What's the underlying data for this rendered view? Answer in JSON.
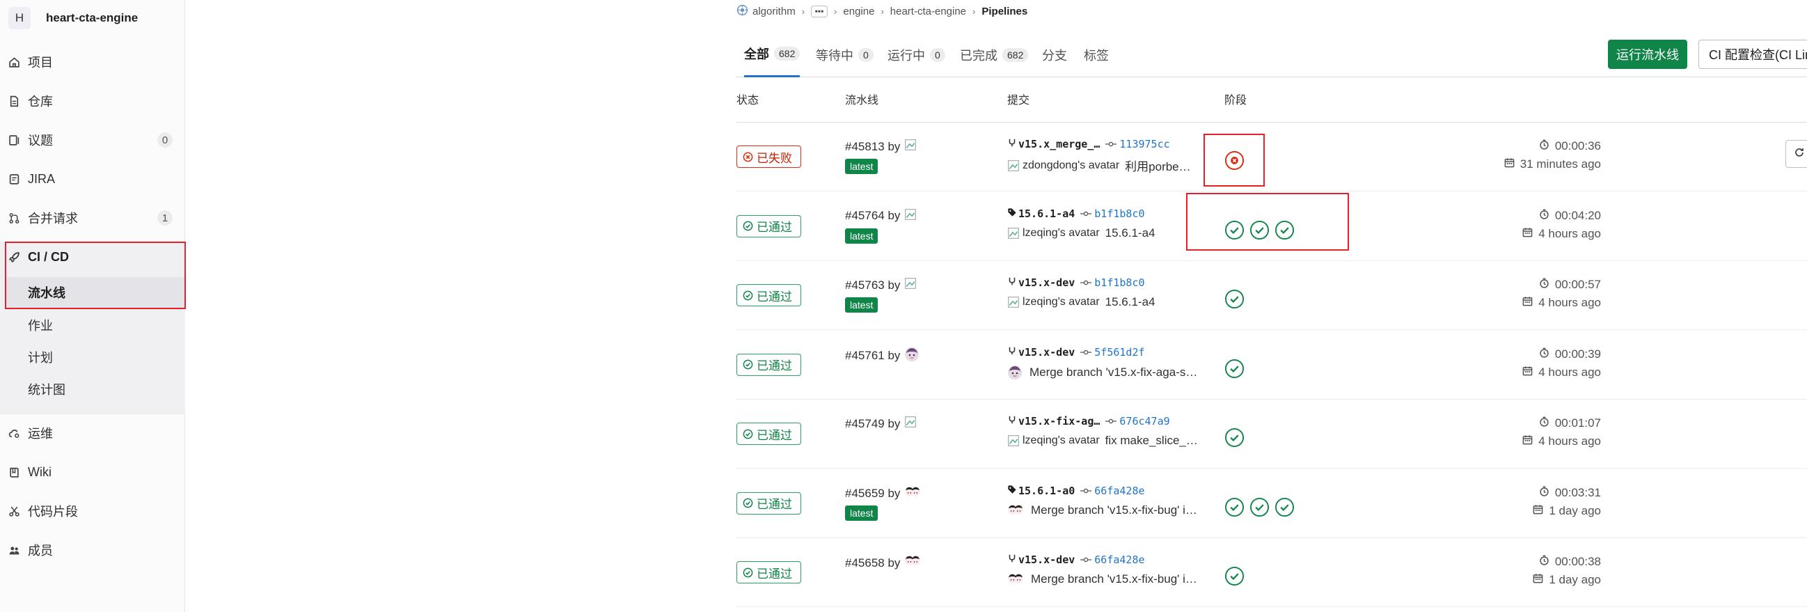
{
  "sidebar": {
    "avatar_letter": "H",
    "project_name": "heart-cta-engine",
    "items": [
      {
        "label": "项目",
        "icon": "home-icon"
      },
      {
        "label": "仓库",
        "icon": "file-icon"
      },
      {
        "label": "议题",
        "icon": "issues-icon",
        "badge": "0"
      },
      {
        "label": "JIRA",
        "icon": "jira-icon"
      },
      {
        "label": "合并请求",
        "icon": "merge-request-icon",
        "badge": "1"
      },
      {
        "label": "CI / CD",
        "icon": "rocket-icon"
      },
      {
        "label": "运维",
        "icon": "cloud-gear-icon"
      },
      {
        "label": "Wiki",
        "icon": "book-icon"
      },
      {
        "label": "代码片段",
        "icon": "scissors-icon"
      },
      {
        "label": "成员",
        "icon": "users-icon"
      }
    ],
    "cicd_sub": [
      "流水线",
      "作业",
      "计划",
      "统计图"
    ]
  },
  "breadcrumb": {
    "group": "algorithm",
    "more": "•••",
    "sub": "engine",
    "project": "heart-cta-engine",
    "current": "Pipelines"
  },
  "tabs": [
    {
      "label": "全部",
      "count": "682"
    },
    {
      "label": "等待中",
      "count": "0"
    },
    {
      "label": "运行中",
      "count": "0"
    },
    {
      "label": "已完成",
      "count": "682"
    },
    {
      "label": "分支",
      "count": ""
    },
    {
      "label": "标签",
      "count": ""
    }
  ],
  "buttons": {
    "run_pipeline": "运行流水线",
    "ci_lint": "CI 配置检查(CI Lint)"
  },
  "columns": {
    "status": "状态",
    "pipeline": "流水线",
    "commit": "提交",
    "stages": "阶段"
  },
  "rows": [
    {
      "status": "已失败",
      "status_type": "failed",
      "id": "#45813 by",
      "latest": "latest",
      "ref_type": "branch",
      "ref": "v15.x_merge_…",
      "sha": "113975cc",
      "author_alt": "zdongdong's avatar",
      "message": "利用porbe…",
      "stages": [
        "failed"
      ],
      "duration": "00:00:36",
      "ago": "31 minutes ago"
    },
    {
      "status": "已通过",
      "status_type": "passed",
      "id": "#45764 by",
      "latest": "latest",
      "ref_type": "tag",
      "ref": "15.6.1-a4",
      "sha": "b1f1b8c0",
      "author_alt": "lzeqing's avatar",
      "message": "15.6.1-a4",
      "stages": [
        "passed",
        "passed",
        "passed"
      ],
      "duration": "00:04:20",
      "ago": "4 hours ago"
    },
    {
      "status": "已通过",
      "status_type": "passed",
      "id": "#45763 by",
      "latest": "latest",
      "ref_type": "branch",
      "ref": "v15.x-dev",
      "sha": "b1f1b8c0",
      "author_alt": "lzeqing's avatar",
      "message": "15.6.1-a4",
      "stages": [
        "passed"
      ],
      "duration": "00:00:57",
      "ago": "4 hours ago"
    },
    {
      "status": "已通过",
      "status_type": "passed",
      "id": "#45761 by",
      "latest": "",
      "ref_type": "branch",
      "ref": "v15.x-dev",
      "sha": "5f561d2f",
      "author_alt": "",
      "message": "Merge branch 'v15.x-fix-aga-s…",
      "stages": [
        "passed"
      ],
      "duration": "00:00:39",
      "ago": "4 hours ago"
    },
    {
      "status": "已通过",
      "status_type": "passed",
      "id": "#45749 by",
      "latest": "",
      "ref_type": "branch",
      "ref": "v15.x-fix-ag…",
      "sha": "676c47a9",
      "author_alt": "lzeqing's avatar",
      "message": "fix make_slice_…",
      "stages": [
        "passed"
      ],
      "duration": "00:01:07",
      "ago": "4 hours ago"
    },
    {
      "status": "已通过",
      "status_type": "passed",
      "id": "#45659 by",
      "latest": "latest",
      "ref_type": "tag",
      "ref": "15.6.1-a0",
      "sha": "66fa428e",
      "author_alt": "",
      "message": "Merge branch 'v15.x-fix-bug' i…",
      "stages": [
        "passed",
        "passed",
        "passed"
      ],
      "duration": "00:03:31",
      "ago": "1 day ago"
    },
    {
      "status": "已通过",
      "status_type": "passed",
      "id": "#45658 by",
      "latest": "",
      "ref_type": "branch",
      "ref": "v15.x-dev",
      "sha": "66fa428e",
      "author_alt": "",
      "message": "Merge branch 'v15.x-fix-bug' i…",
      "stages": [
        "passed"
      ],
      "duration": "00:00:38",
      "ago": "1 day ago"
    }
  ]
}
